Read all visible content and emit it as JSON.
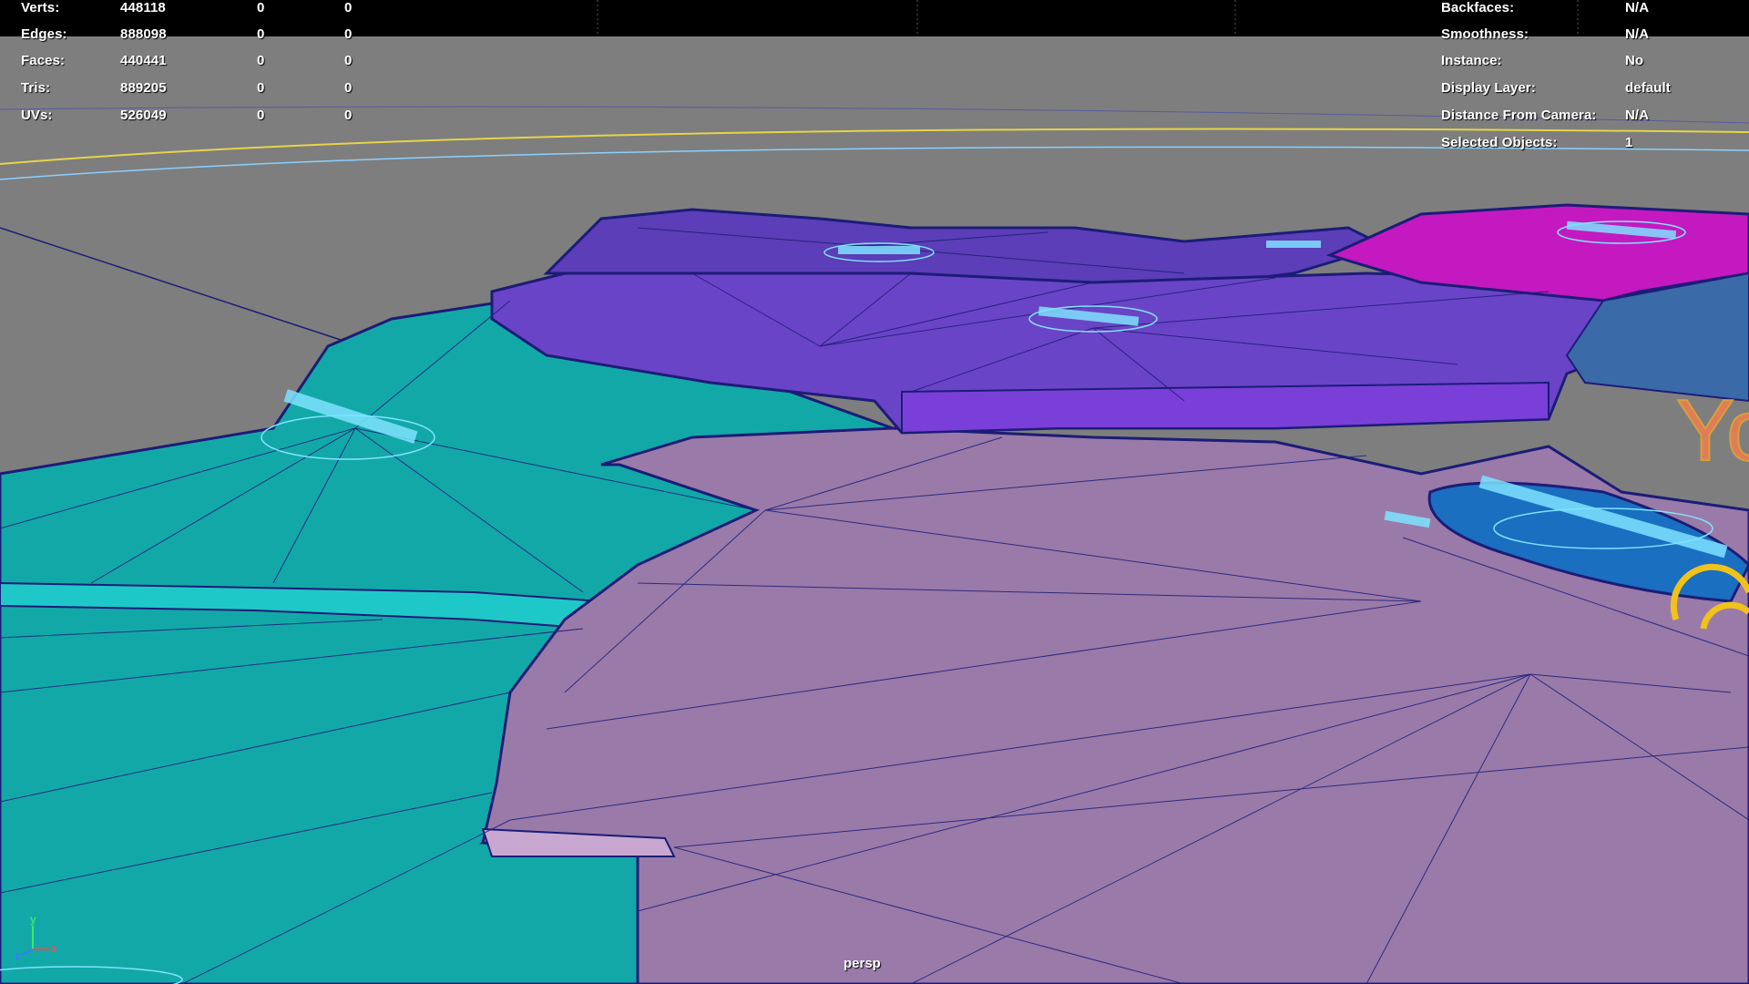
{
  "hud_left": {
    "rows": [
      {
        "label": "Verts:",
        "value": "448118",
        "a": "0",
        "b": "0"
      },
      {
        "label": "Edges:",
        "value": "888098",
        "a": "0",
        "b": "0"
      },
      {
        "label": "Faces:",
        "value": "440441",
        "a": "0",
        "b": "0"
      },
      {
        "label": "Tris:",
        "value": "889205",
        "a": "0",
        "b": "0"
      },
      {
        "label": "UVs:",
        "value": "526049",
        "a": "0",
        "b": "0"
      }
    ]
  },
  "hud_right": {
    "rows": [
      {
        "label": "Backfaces:",
        "value": "N/A"
      },
      {
        "label": "Smoothness:",
        "value": "N/A"
      },
      {
        "label": "Instance:",
        "value": "No"
      },
      {
        "label": "Display Layer:",
        "value": "default"
      },
      {
        "label": "Distance From Camera:",
        "value": "N/A"
      },
      {
        "label": "Selected Objects:",
        "value": "1"
      }
    ]
  },
  "viewport": {
    "camera": "persp",
    "partial_text": "Yo",
    "axis": {
      "y": "y",
      "z": "z",
      "x": "x"
    }
  },
  "colors": {
    "background": "#7e7e7e",
    "teal": "#13a8a8",
    "lilac": "#9a7aa8",
    "violet": "#6a44c6",
    "magenta": "#c419c0",
    "wire": "#1c1c78",
    "selected_outline": "#7fe3ff"
  }
}
